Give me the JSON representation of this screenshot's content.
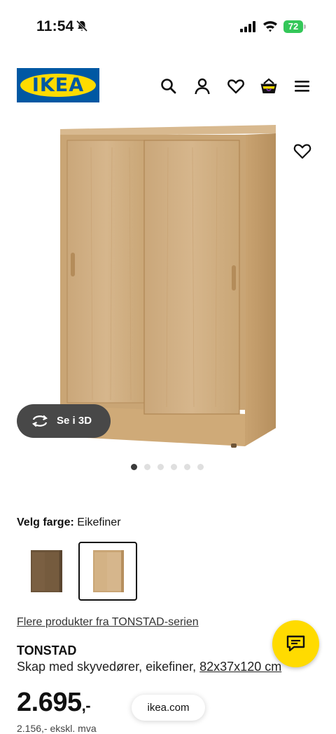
{
  "status_bar": {
    "time": "11:54",
    "battery": "72"
  },
  "header": {
    "logo_text": "IKEA",
    "icons": [
      "search-icon",
      "profile-icon",
      "heart-icon",
      "cart-icon",
      "menu-icon"
    ]
  },
  "gallery": {
    "view_3d_label": "Se i 3D",
    "image_count": 6,
    "active_index": 0
  },
  "color": {
    "label": "Velg farge:",
    "value": "Eikefiner",
    "options": [
      "dark-brown",
      "oak"
    ],
    "selected_index": 1
  },
  "series_link": "Flere produkter fra TONSTAD-serien",
  "product": {
    "name": "TONSTAD",
    "description": "Skap med skyvedører, eikefiner,",
    "dimensions": "82x37x120 cm",
    "price": "2.695",
    "price_suffix": ",-",
    "price_ex_vat": "2.156,- ekskl. mva"
  },
  "browser": {
    "url": "ikea.com"
  },
  "colors": {
    "brand_blue": "#0058a3",
    "brand_yellow": "#ffdb00"
  }
}
